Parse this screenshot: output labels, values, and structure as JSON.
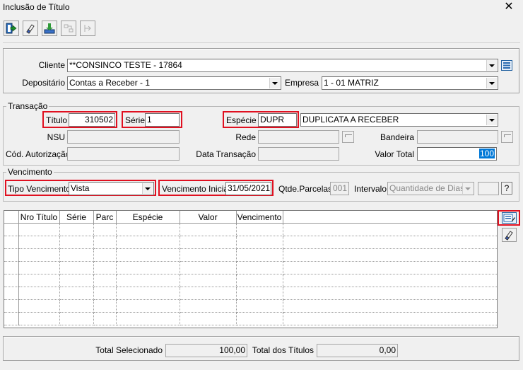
{
  "window": {
    "title": "Inclusão de Título",
    "close_glyph": "✕"
  },
  "toolbar": {
    "icons": [
      "exit-icon",
      "eraser-icon",
      "save-icon",
      "move-disabled-icon",
      "arrow-disabled-icon"
    ]
  },
  "header": {
    "cliente": {
      "label": "Cliente",
      "value": "**CONSINCO TESTE - 17864"
    },
    "depositario": {
      "label": "Depositário",
      "value": "Contas a Receber - 1"
    },
    "empresa": {
      "label": "Empresa",
      "value": "1 - 01 MATRIZ"
    }
  },
  "transacao": {
    "legend": "Transação",
    "titulo": {
      "label": "Título",
      "value": "310502"
    },
    "serie": {
      "label": "Série",
      "value": "1"
    },
    "especie": {
      "label": "Espécie",
      "code": "DUPR",
      "desc": "DUPLICATA A RECEBER"
    },
    "nsu": {
      "label": "NSU",
      "value": ""
    },
    "rede": {
      "label": "Rede",
      "value": ""
    },
    "bandeira": {
      "label": "Bandeira",
      "value": ""
    },
    "cod_autorizacao": {
      "label": "Cód. Autorização",
      "value": ""
    },
    "data_transacao": {
      "label": "Data Transação",
      "value": ""
    },
    "valor_total": {
      "label": "Valor Total",
      "value": "100"
    }
  },
  "vencimento": {
    "legend": "Vencimento",
    "tipo": {
      "label": "Tipo Vencimento",
      "value": "Vista"
    },
    "inicial": {
      "label": "Vencimento Inicial",
      "value": "31/05/2021"
    },
    "qtde_parcelas": {
      "label": "Qtde.Parcelas",
      "value": "001"
    },
    "intervalo": {
      "label": "Intervalo",
      "value": "Quantidade de Dias",
      "extra": ""
    },
    "help": "?"
  },
  "grid": {
    "columns": [
      "Nro Título",
      "Série",
      "Parc",
      "Espécie",
      "Valor",
      "Vencimento"
    ],
    "rows": 8
  },
  "totals": {
    "selecionado": {
      "label": "Total Selecionado",
      "value": "100,00"
    },
    "titulos": {
      "label": "Total dos Títulos",
      "value": "0,00"
    }
  }
}
